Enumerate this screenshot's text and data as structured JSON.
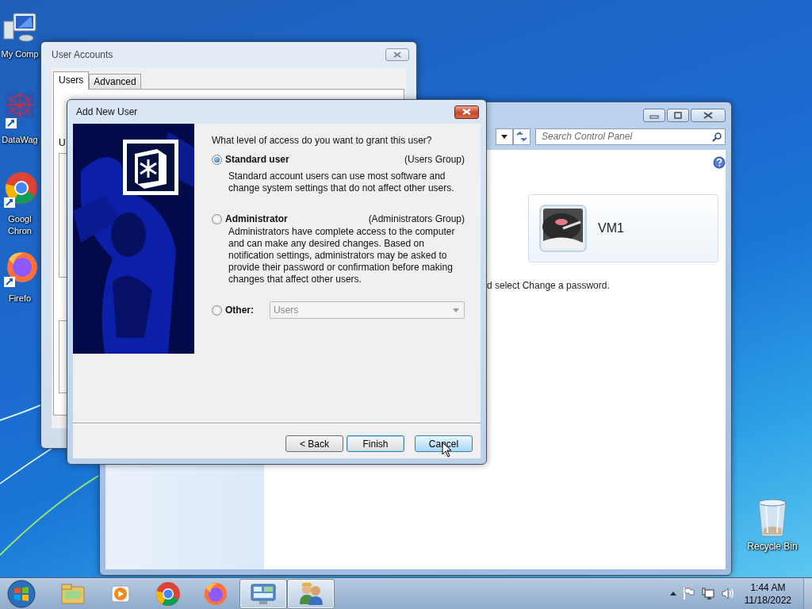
{
  "desktop_icons": [
    {
      "kind": "computer",
      "label": "My Comp"
    },
    {
      "kind": "shortcut-app",
      "label": "DataWag"
    },
    {
      "kind": "chrome",
      "label": "Googl Chron"
    },
    {
      "kind": "firefox",
      "label": "Firefo"
    }
  ],
  "recycle_bin": {
    "label": "Recycle Bin"
  },
  "control_panel": {
    "search": {
      "placeholder": "Search Control Panel"
    },
    "account": {
      "name": "VM1"
    },
    "hint": "d select Change a password."
  },
  "user_accounts": {
    "title": "User Accounts",
    "tabs": [
      {
        "label": "Users",
        "selected": true
      },
      {
        "label": "Advanced",
        "selected": false
      }
    ],
    "label": "U"
  },
  "dialog": {
    "title": "Add New User",
    "question": "What level of access do you want to grant this user?",
    "options": [
      {
        "kind": "described",
        "label": "Standard user",
        "group": "(Users Group)",
        "description": "Standard account users can use most software and change system settings that do not affect other users.",
        "selected": true
      },
      {
        "kind": "described",
        "label": "Administrator",
        "group": "(Administrators Group)",
        "description": "Administrators have complete access to the computer and can make any desired changes. Based on notification settings, administrators may be asked to provide their password or confirmation before making changes that affect other users.",
        "selected": false
      },
      {
        "kind": "dropdown",
        "label": "Other:",
        "value": "Users",
        "disabled": true,
        "selected": false
      }
    ],
    "buttons": [
      {
        "label": "< Back",
        "default": false,
        "hover": false
      },
      {
        "label": "Finish",
        "default": true,
        "hover": false
      },
      {
        "label": "Cancel",
        "default": false,
        "hover": true
      }
    ]
  },
  "taskbar": {
    "apps": [
      {
        "kind": "explorer",
        "running": false
      },
      {
        "kind": "media",
        "running": false
      },
      {
        "kind": "chrome",
        "running": false
      },
      {
        "kind": "firefox",
        "running": false
      },
      {
        "kind": "control-panel",
        "running": true
      },
      {
        "kind": "users",
        "running": true
      }
    ],
    "time": "1:44 AM",
    "date": "11/18/2022"
  }
}
